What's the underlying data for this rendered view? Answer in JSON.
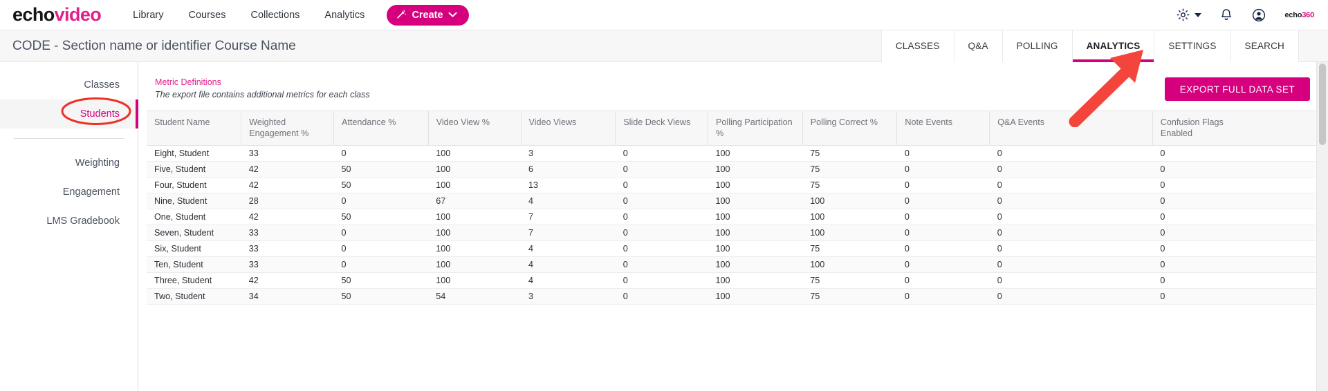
{
  "topnav": {
    "brand_first": "echo",
    "brand_second": "video",
    "links": [
      {
        "label": "Library"
      },
      {
        "label": "Courses"
      },
      {
        "label": "Collections"
      },
      {
        "label": "Analytics"
      }
    ],
    "create_label": "Create",
    "create_icon": "magic-wand-icon",
    "gear_icon": "gear-icon",
    "bell_icon": "bell-icon",
    "account_icon": "user-account-icon",
    "org_logo_first": "echo",
    "org_logo_second": "360",
    "accent_color": "#d6007f"
  },
  "subheader": {
    "course_title": "CODE - Section name or identifier Course Name",
    "tabs": [
      {
        "label": "CLASSES",
        "active": false
      },
      {
        "label": "Q&A",
        "active": false
      },
      {
        "label": "POLLING",
        "active": false
      },
      {
        "label": "ANALYTICS",
        "active": true
      },
      {
        "label": "SETTINGS",
        "active": false
      },
      {
        "label": "SEARCH",
        "active": false
      }
    ]
  },
  "sidebar": {
    "items": [
      {
        "label": "Classes",
        "active": false
      },
      {
        "label": "Students",
        "active": true
      },
      {
        "label": "Weighting",
        "active": false
      },
      {
        "label": "Engagement",
        "active": false
      },
      {
        "label": "LMS Gradebook",
        "active": false
      }
    ]
  },
  "content": {
    "metric_definitions_link": "Metric Definitions",
    "metric_definitions_note": "The export file contains additional metrics for each class",
    "export_button_label": "EXPORT FULL DATA SET"
  },
  "table": {
    "columns": [
      "Student Name",
      "Weighted Engagement %",
      "Attendance %",
      "Video View %",
      "Video Views",
      "Slide Deck Views",
      "Polling Participation %",
      "Polling Correct %",
      "Note Events",
      "Q&A Events",
      "Confusion Flags Enabled"
    ],
    "columns_display": [
      "Student Name",
      "Weighted\nEngagement %",
      "Attendance %",
      "Video View %",
      "Video Views",
      "Slide Deck Views",
      "Polling Participation\n%",
      "Polling Correct %",
      "Note Events",
      "Q&A Events",
      "Confusion Flags\nEnabled"
    ],
    "rows": [
      [
        "Eight, Student",
        "33",
        "0",
        "100",
        "3",
        "0",
        "100",
        "75",
        "0",
        "0",
        "0"
      ],
      [
        "Five, Student",
        "42",
        "50",
        "100",
        "6",
        "0",
        "100",
        "75",
        "0",
        "0",
        "0"
      ],
      [
        "Four, Student",
        "42",
        "50",
        "100",
        "13",
        "0",
        "100",
        "75",
        "0",
        "0",
        "0"
      ],
      [
        "Nine, Student",
        "28",
        "0",
        "67",
        "4",
        "0",
        "100",
        "100",
        "0",
        "0",
        "0"
      ],
      [
        "One, Student",
        "42",
        "50",
        "100",
        "7",
        "0",
        "100",
        "100",
        "0",
        "0",
        "0"
      ],
      [
        "Seven, Student",
        "33",
        "0",
        "100",
        "7",
        "0",
        "100",
        "100",
        "0",
        "0",
        "0"
      ],
      [
        "Six, Student",
        "33",
        "0",
        "100",
        "4",
        "0",
        "100",
        "75",
        "0",
        "0",
        "0"
      ],
      [
        "Ten, Student",
        "33",
        "0",
        "100",
        "4",
        "0",
        "100",
        "100",
        "0",
        "0",
        "0"
      ],
      [
        "Three, Student",
        "42",
        "50",
        "100",
        "4",
        "0",
        "100",
        "75",
        "0",
        "0",
        "0"
      ],
      [
        "Two, Student",
        "34",
        "50",
        "54",
        "3",
        "0",
        "100",
        "75",
        "0",
        "0",
        "0"
      ]
    ]
  },
  "annotations": {
    "arrow_color": "#f4453c",
    "ellipse_color": "#ee3124",
    "arrow_target": "ANALYTICS",
    "ellipse_target": "Students"
  }
}
